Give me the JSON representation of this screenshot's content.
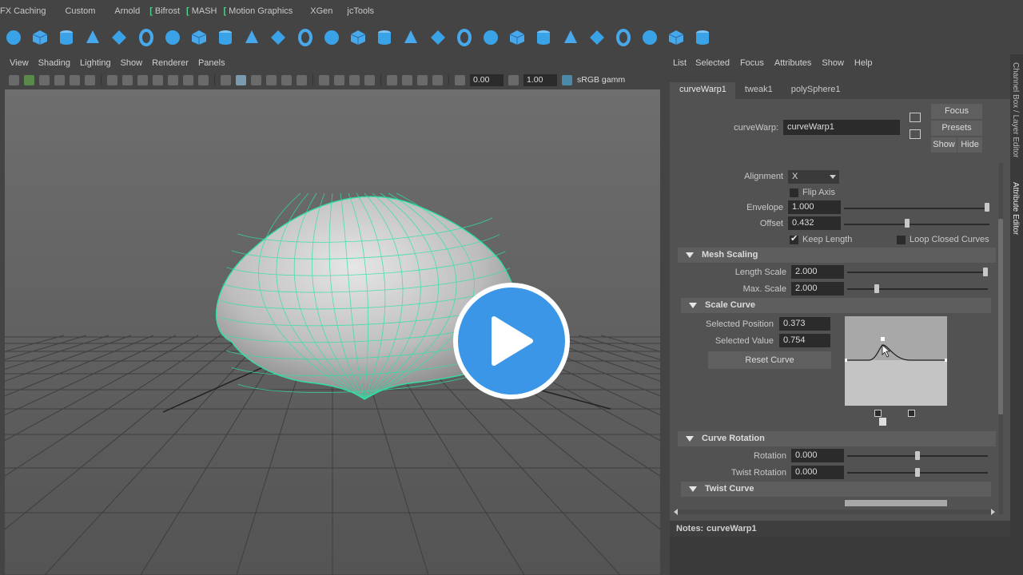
{
  "shelf": {
    "tabs": [
      "FX Caching",
      "Custom",
      "Arnold",
      "Bifrost",
      "MASH",
      "Motion Graphics",
      "XGen",
      "jcTools"
    ],
    "icon_names": [
      "nurbs-sphere-icon",
      "poly-cube-icon",
      "poly-cylinder-icon",
      "poly-cone-icon",
      "poly-plane-icon",
      "poly-torus-icon",
      "poly-pipe-icon",
      "poly-helix-icon",
      "poly-gear-icon",
      "poly-soccer-icon",
      "poly-platonic-icon",
      "extrude-icon",
      "bridge-icon",
      "bevel-icon",
      "append-icon",
      "boolean-icon",
      "multi-cut-icon",
      "target-weld-icon",
      "smooth-icon",
      "combine-icon",
      "separate-icon",
      "mirror-icon",
      "bend-icon",
      "quad-draw-icon",
      "uv-editor-icon",
      "sculpt-icon",
      "crease-icon"
    ],
    "accent": "#4fd08a"
  },
  "viewport": {
    "menu": [
      "View",
      "Shading",
      "Lighting",
      "Show",
      "Renderer",
      "Panels"
    ],
    "exposure": "0.00",
    "gamma": "1.00",
    "color_space": "sRGB gamm",
    "mesh_wire_color": "#2fe0a6"
  },
  "attribute_editor": {
    "menu": [
      "List",
      "Selected",
      "Focus",
      "Attributes",
      "Show",
      "Help"
    ],
    "tabs": [
      "curveWarp1",
      "tweak1",
      "polySphere1"
    ],
    "node_type_label": "curveWarp:",
    "node_name": "curveWarp1",
    "buttons": {
      "focus": "Focus",
      "presets": "Presets",
      "show": "Show",
      "hide": "Hide"
    },
    "alignment": {
      "label": "Alignment",
      "value": "X"
    },
    "flip_axis": "Flip Axis",
    "envelope": {
      "label": "Envelope",
      "value": "1.000",
      "slider": 1.0
    },
    "offset": {
      "label": "Offset",
      "value": "0.432",
      "slider": 0.432
    },
    "keep_length": "Keep Length",
    "loop_closed_curves": "Loop Closed Curves",
    "mesh_scaling": {
      "title": "Mesh Scaling",
      "length_scale": {
        "label": "Length Scale",
        "value": "2.000",
        "slider": 1.0
      },
      "max_scale": {
        "label": "Max. Scale",
        "value": "2.000",
        "slider": 0.2
      }
    },
    "scale_curve": {
      "title": "Scale Curve",
      "selected_position": {
        "label": "Selected Position",
        "value": "0.373"
      },
      "selected_value": {
        "label": "Selected Value",
        "value": "0.754"
      },
      "reset": "Reset Curve"
    },
    "curve_rotation": {
      "title": "Curve Rotation",
      "rotation": {
        "label": "Rotation",
        "value": "0.000",
        "slider": 0.5
      },
      "twist_rotation": {
        "label": "Twist Rotation",
        "value": "0.000",
        "slider": 0.5
      }
    },
    "twist_curve": {
      "title": "Twist Curve"
    },
    "notes_label": "Notes:",
    "notes_node": "curveWarp1"
  },
  "side_tabs": [
    "Channel Box / Layer Editor",
    "Attribute Editor"
  ]
}
